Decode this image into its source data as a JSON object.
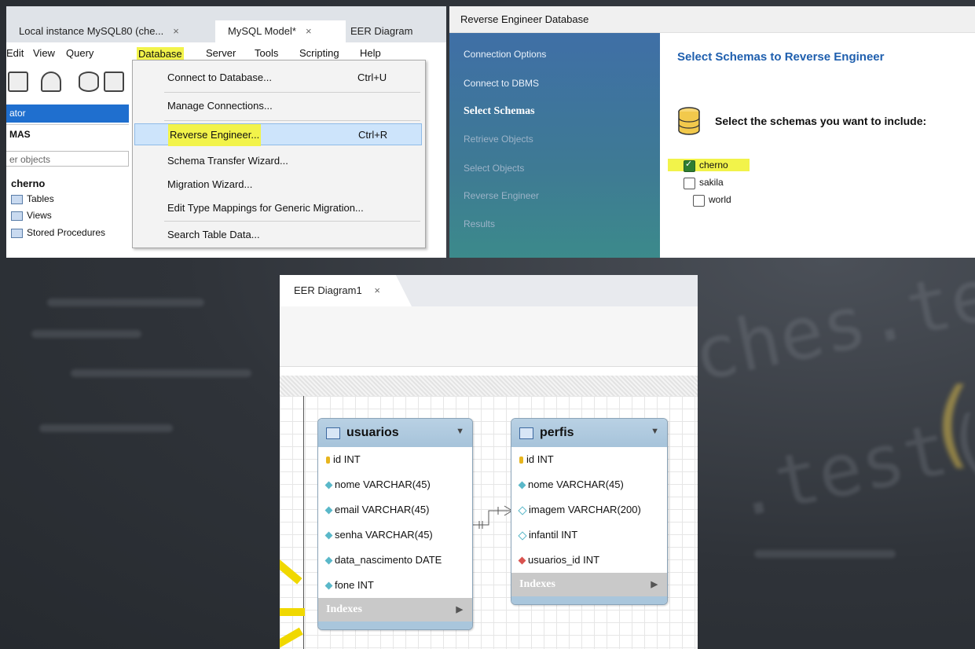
{
  "workbench": {
    "tabs": [
      {
        "label": "Local instance MySQL80 (che...",
        "close": "×"
      },
      {
        "label": "MySQL Model*",
        "close": "×"
      },
      {
        "label": "EER Diagram",
        "close": ""
      }
    ],
    "menu": [
      "Edit",
      "View",
      "Query",
      "Database",
      "Server",
      "Tools",
      "Scripting",
      "Help"
    ],
    "navigator_label": "ator",
    "schemas_label": "MAS",
    "filter_placeholder": "er objects",
    "tree": {
      "schema": "cherno",
      "items": [
        "Tables",
        "Views",
        "Stored Procedures"
      ]
    },
    "dropdown": [
      {
        "label": "Connect to Database...",
        "shortcut": "Ctrl+U"
      },
      {
        "label": "Manage Connections...",
        "shortcut": ""
      },
      {
        "label": "Reverse Engineer...",
        "shortcut": "Ctrl+R"
      },
      {
        "label": "Schema Transfer Wizard...",
        "shortcut": ""
      },
      {
        "label": "Migration Wizard...",
        "shortcut": ""
      },
      {
        "label": "Edit Type Mappings for Generic Migration...",
        "shortcut": ""
      },
      {
        "label": "Search Table Data...",
        "shortcut": ""
      }
    ]
  },
  "wizard": {
    "title": "Reverse Engineer Database",
    "steps": [
      "Connection Options",
      "Connect to DBMS",
      "Select Schemas",
      "Retrieve Objects",
      "Select Objects",
      "Reverse Engineer",
      "Results"
    ],
    "current_step": "Select Schemas",
    "heading": "Select Schemas to Reverse Engineer",
    "subheading": "Select the schemas you want to include:",
    "schemas": [
      {
        "name": "cherno",
        "checked": true
      },
      {
        "name": "sakila",
        "checked": false
      },
      {
        "name": "world",
        "checked": false
      }
    ]
  },
  "eer": {
    "tab": {
      "label": "EER Diagram1",
      "close": "×"
    },
    "tables": [
      {
        "name": "usuarios",
        "columns": [
          "id INT",
          "nome VARCHAR(45)",
          "email VARCHAR(45)",
          "senha VARCHAR(45)",
          "data_nascimento DATE",
          "fone INT"
        ],
        "indexes": "Indexes"
      },
      {
        "name": "perfis",
        "columns": [
          "id INT",
          "nome VARCHAR(45)",
          "imagem VARCHAR(200)",
          "infantil INT",
          "usuarios_id INT"
        ],
        "indexes": "Indexes"
      }
    ]
  },
  "background_code": {
    "line1": "ches.te",
    "line2": ".test(",
    "paren": "("
  },
  "colors": {
    "highlight": "#f2f34a",
    "wizard_heading": "#1f5fae",
    "menu_selected": "#1f6fcf"
  }
}
